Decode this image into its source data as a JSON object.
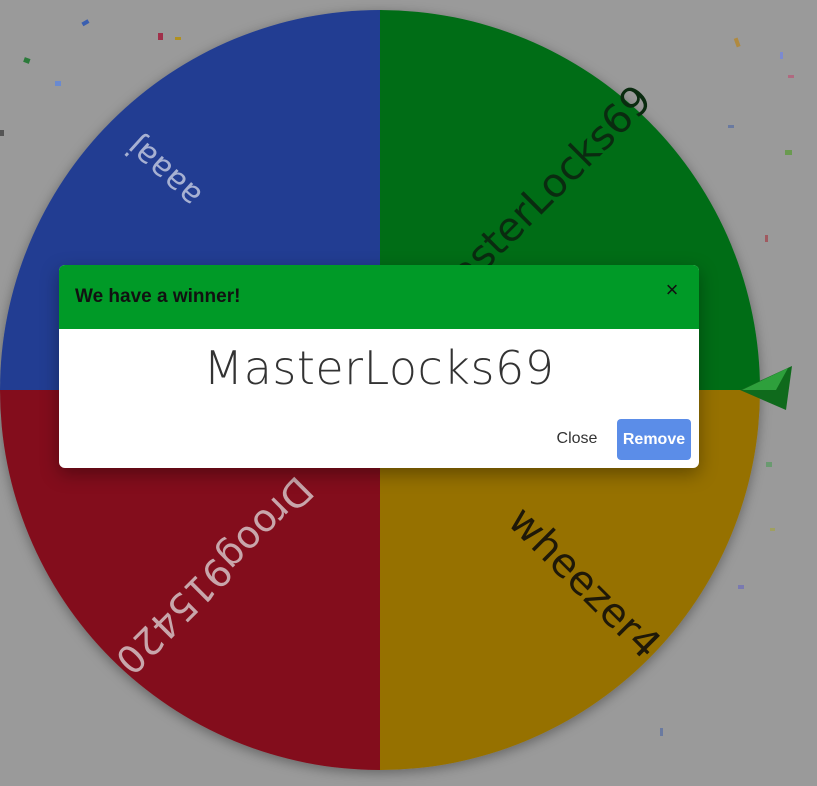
{
  "wheel": {
    "segments": [
      {
        "label": "aaaaj",
        "color": "#213e92"
      },
      {
        "label": "MasterLocks69",
        "color": "#006d17"
      },
      {
        "label": "wheezer4",
        "color": "#967101"
      },
      {
        "label": "Droog915420",
        "color": "#830b1a"
      }
    ],
    "pointer_color": "#1e8f2d"
  },
  "modal": {
    "title": "We have a winner!",
    "close_icon": "×",
    "winner": "MasterLocks69",
    "close_label": "Close",
    "remove_label": "Remove",
    "header_color": "#009a27",
    "remove_color": "#5b8de8"
  }
}
